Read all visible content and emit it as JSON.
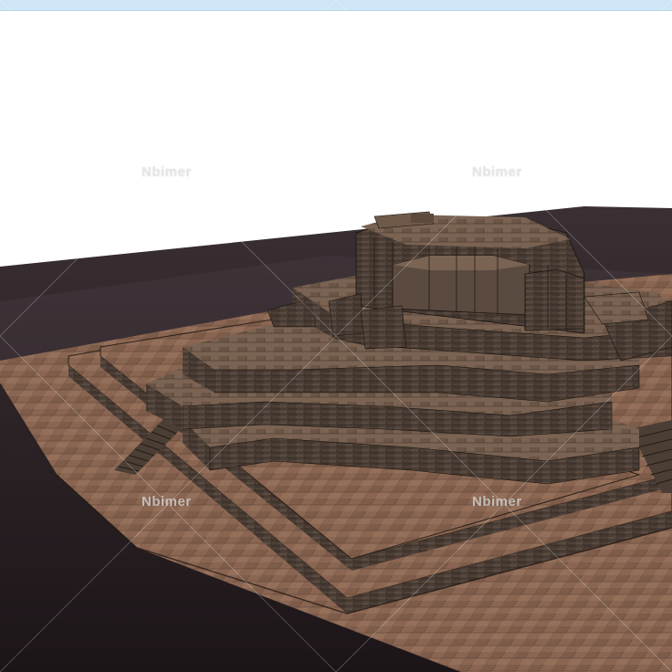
{
  "watermark": {
    "text": "Nbimer"
  },
  "scene": {
    "subject": "terraced stone temple model",
    "colors": {
      "sky": "#ffffff",
      "ground": "#2a1f22",
      "floor": "#8b6650",
      "stone_top": "#6f5a4a",
      "stone_wall": "#4c3f36",
      "edge": "#1a1410"
    }
  }
}
